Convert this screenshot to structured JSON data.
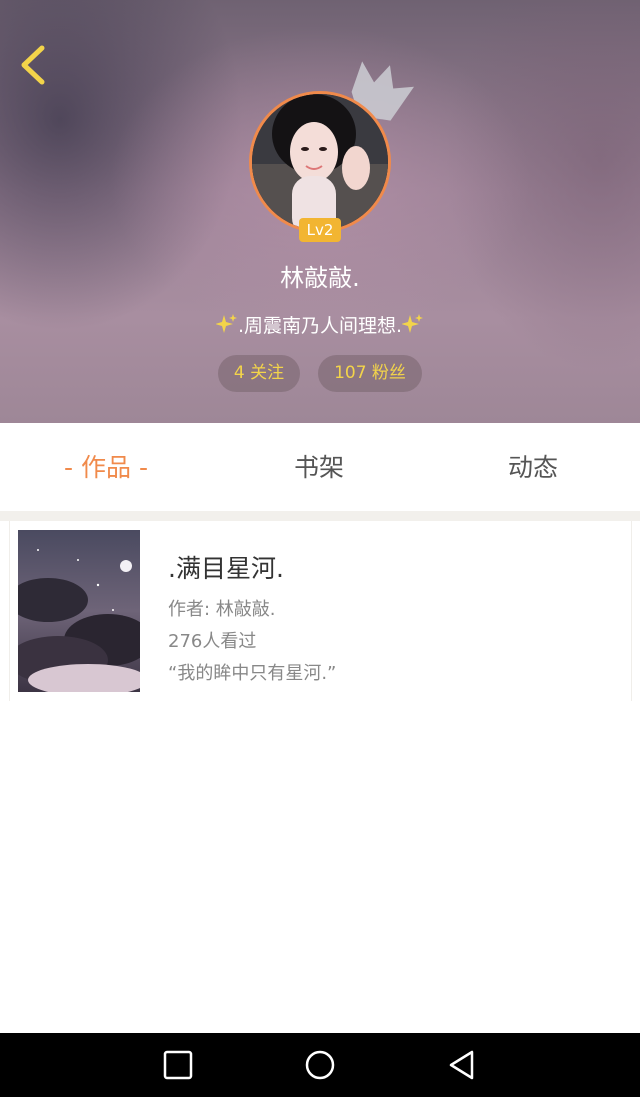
{
  "header": {
    "level_badge": "Lv2",
    "username": "林敲敲.",
    "signature": ".周震南乃人间理想.",
    "follow_label": "4 关注",
    "fans_label": "107 粉丝"
  },
  "tabs": [
    {
      "label": "- 作品 -",
      "active": true
    },
    {
      "label": "书架",
      "active": false
    },
    {
      "label": "动态",
      "active": false
    }
  ],
  "works": [
    {
      "title": ".满目星河.",
      "author": "作者: 林敲敲.",
      "views": "276人看过",
      "quote": "“我的眸中只有星河.”"
    }
  ],
  "colors": {
    "accent": "#f08a4b",
    "badge": "#f2b532",
    "pill_text": "#f3d44a"
  },
  "icons": {
    "back": "chevron-left-icon",
    "crown": "crown-icon",
    "sparkle": "sparkle-icon",
    "nav_recent": "square-icon",
    "nav_home": "circle-icon",
    "nav_back": "triangle-back-icon"
  }
}
